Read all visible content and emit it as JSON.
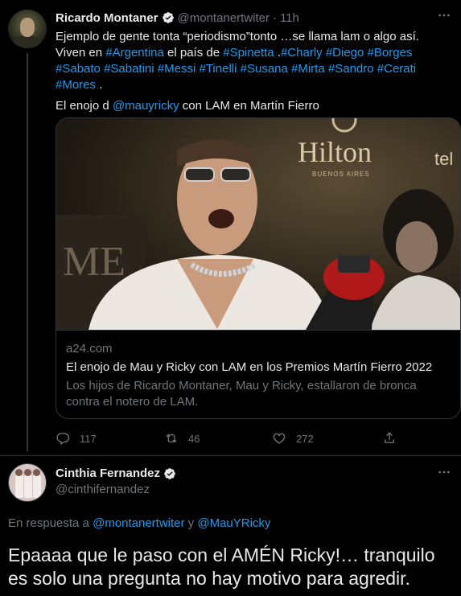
{
  "tweet": {
    "author_name": "Ricardo Montaner",
    "author_handle": "@montanertwiter",
    "separator": "·",
    "time": "11h",
    "more_icon": "more-icon",
    "text": {
      "line1": "Ejemplo de gente tonta “periodismo”tonto …se llama lam o algo así.",
      "line2_parts": [
        {
          "t": "Viven en ",
          "hl": false
        },
        {
          "t": "#Argentina",
          "hl": true
        },
        {
          "t": " el país de ",
          "hl": false
        },
        {
          "t": "#Spinetta",
          "hl": true
        },
        {
          "t": " .",
          "hl": false
        },
        {
          "t": "#Charly",
          "hl": true
        },
        {
          "t": " ",
          "hl": false
        },
        {
          "t": "#Diego",
          "hl": true
        },
        {
          "t": " ",
          "hl": false
        },
        {
          "t": "#Borges",
          "hl": true
        },
        {
          "t": " ",
          "hl": false
        },
        {
          "t": "#Sabato",
          "hl": true
        },
        {
          "t": " ",
          "hl": false
        },
        {
          "t": "#Sabatini",
          "hl": true
        },
        {
          "t": "  ",
          "hl": false
        },
        {
          "t": "#Messi",
          "hl": true
        },
        {
          "t": " ",
          "hl": false
        },
        {
          "t": "#Tinelli",
          "hl": true
        },
        {
          "t": " ",
          "hl": false
        },
        {
          "t": "#Susana",
          "hl": true
        },
        {
          "t": " ",
          "hl": false
        },
        {
          "t": "#Mirta",
          "hl": true
        },
        {
          "t": "  ",
          "hl": false
        },
        {
          "t": "#Sandro",
          "hl": true
        },
        {
          "t": " ",
          "hl": false
        },
        {
          "t": "#Cerati",
          "hl": true
        },
        {
          "t": " ",
          "hl": false
        },
        {
          "t": "#Mores",
          "hl": true
        },
        {
          "t": " .",
          "hl": false
        }
      ],
      "line3_prefix": "El enojo d ",
      "line3_mention": "@mauyricky",
      "line3_suffix": " con LAM en Martín Fierro"
    },
    "card": {
      "image_sign_brand": "Hilton",
      "image_sign_city": "BUENOS AIRES",
      "image_sign_partial": "tel",
      "image_backdrop_letters": "ME",
      "domain": "a24.com",
      "title": "El enojo de Mau y Ricky con LAM en los Premios Martín Fierro 2022",
      "description": "Los hijos de Ricardo Montaner, Mau y Ricky, estallaron de bronca contra el notero de LAM."
    },
    "actions": {
      "replies": "117",
      "retweets": "46",
      "likes": "272"
    }
  },
  "reply": {
    "author_name": "Cinthia Fernandez",
    "author_handle": "@cinthifernandez",
    "reply_to_prefix": "En respuesta a ",
    "reply_to_user1": "@montanertwiter",
    "reply_to_and": " y ",
    "reply_to_user2": "@MauYRicky",
    "text": "Epaaaa que le paso con el AMÉN Ricky!… tranquilo es solo una pregunta no hay motivo para agredir."
  },
  "colors": {
    "background": "#000000",
    "text": "#e7e9ea",
    "muted": "#71767b",
    "accent": "#1d9bf0",
    "border": "#2f3336"
  }
}
